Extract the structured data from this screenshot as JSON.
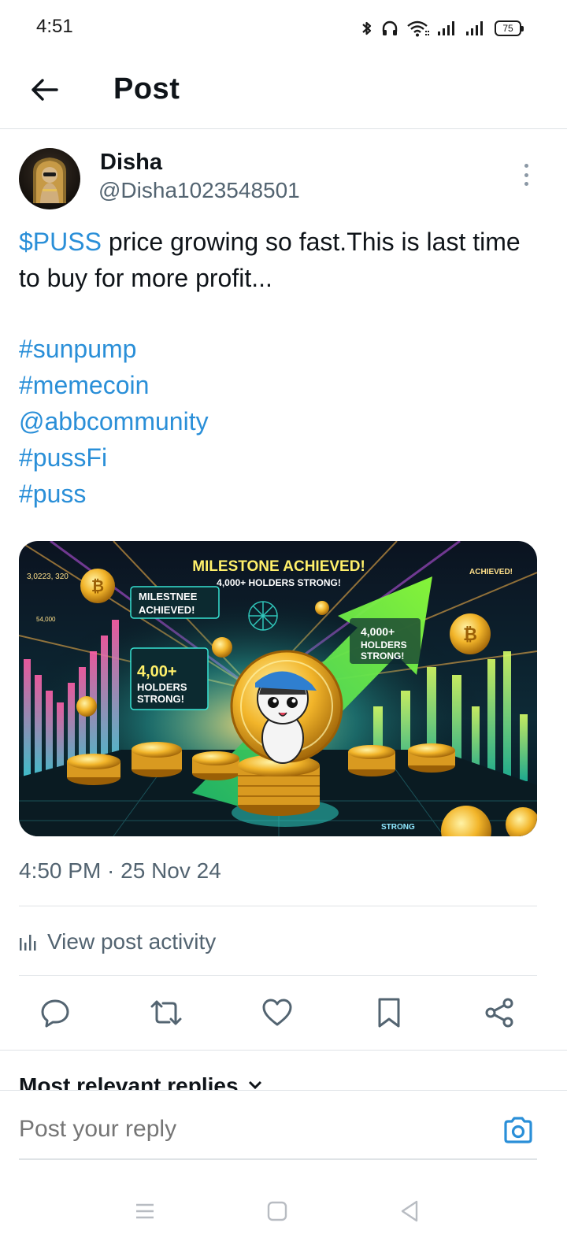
{
  "status_bar": {
    "time": "4:51",
    "battery": "75",
    "icons": [
      "bluetooth-icon",
      "headphones-icon",
      "wifi-icon",
      "signal-icon",
      "signal-icon",
      "battery-icon"
    ]
  },
  "header": {
    "title": "Post",
    "back_icon": "arrow-left-icon"
  },
  "post": {
    "author": {
      "display_name": "Disha",
      "handle": "@Disha1023548501"
    },
    "text": {
      "cashtag": "$PUSS",
      "body": " price growing so fast.This is last time to buy for more profit..."
    },
    "tags": [
      "#sunpump",
      "#memecoin",
      "@abbcommunity",
      "#pussFi",
      "#puss"
    ],
    "media": {
      "banner_title": "MILESTONE ACHIEVED!",
      "banner_subtitle": "4,000+ HOLDERS STRONG!",
      "corner_number": "3,0223, 320",
      "corner_right": "ACHIEVED!",
      "left_panel_title": "MILESTNEE ACHIEVED!",
      "left_card": "4,00+ HOLDERS STRONG!",
      "right_card": "4,000+ HOLDERS STRONG!",
      "small_number": "54,000",
      "bottom_label": "STRONG"
    },
    "timestamp": "4:50 PM · 25 Nov 24",
    "activity_label": "View post activity",
    "actions": [
      "reply-icon",
      "repost-icon",
      "like-icon",
      "bookmark-icon",
      "share-icon"
    ]
  },
  "replies": {
    "sort_label": "Most relevant replies"
  },
  "reply_bar": {
    "placeholder": "Post your reply"
  },
  "colors": {
    "accent": "#2a8fd8",
    "secondary_text": "#536471",
    "divider": "#dfe3e6"
  }
}
